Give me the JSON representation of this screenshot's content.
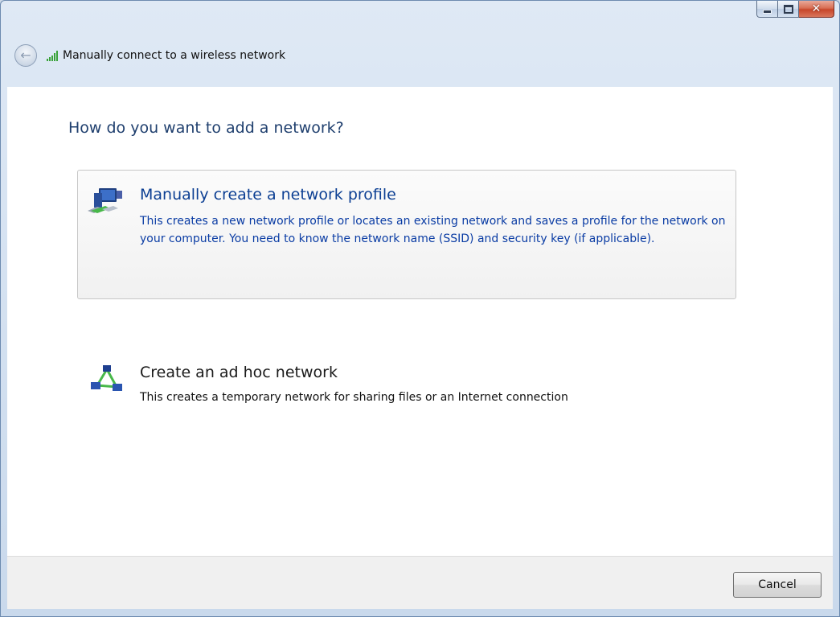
{
  "window": {
    "title": "Manually connect to a wireless network",
    "close_glyph": "✕"
  },
  "nav": {
    "back_icon": "back-arrow-icon",
    "back_glyph": "←"
  },
  "main": {
    "heading": "How do you want to add a network?",
    "options": [
      {
        "title": "Manually create a network profile",
        "description": "This creates a new network profile or locates an existing network and saves a profile for the network on your computer. You need to know the network name (SSID) and security key (if applicable).",
        "icon": "network-profile-icon",
        "selected": true
      },
      {
        "title": "Create an ad hoc network",
        "description": "This creates a temporary network for sharing files or an Internet connection",
        "icon": "ad-hoc-network-icon",
        "selected": false
      }
    ]
  },
  "footer": {
    "cancel_label": "Cancel"
  },
  "colors": {
    "heading": "#1f3f6e",
    "link_title": "#0c3f93",
    "signal": "#3aa23a"
  }
}
